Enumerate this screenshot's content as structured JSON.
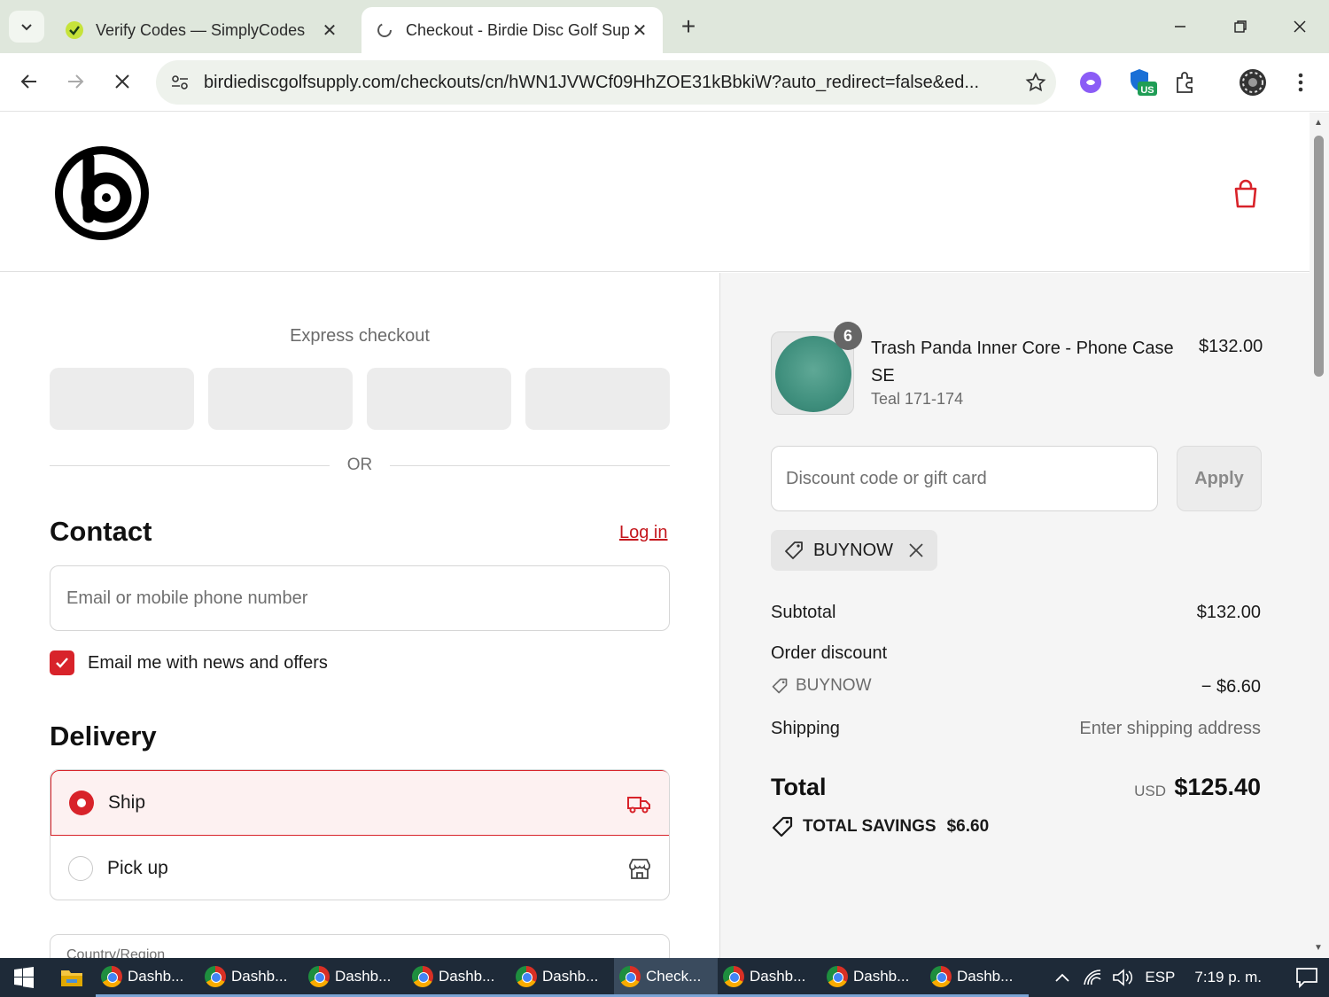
{
  "browser": {
    "tabs": [
      {
        "title": "Verify Codes — SimplyCodes",
        "active": false
      },
      {
        "title": "Checkout - Birdie Disc Golf Sup",
        "active": true
      }
    ],
    "url": "birdiediscgolfsupply.com/checkouts/cn/hWN1JVWCf09HhZOE31kBbkiW?auto_redirect=false&ed...",
    "ext_badge": "US"
  },
  "checkout": {
    "express_title": "Express checkout",
    "or_label": "OR",
    "contact": {
      "title": "Contact",
      "login_label": "Log in",
      "email_placeholder": "Email or mobile phone number",
      "newsletter_label": "Email me with news and offers",
      "newsletter_checked": true
    },
    "delivery": {
      "title": "Delivery",
      "options": [
        {
          "label": "Ship",
          "selected": true,
          "icon": "truck-icon"
        },
        {
          "label": "Pick up",
          "selected": false,
          "icon": "store-icon"
        }
      ],
      "country_label": "Country/Region"
    }
  },
  "summary": {
    "item": {
      "name": "Trash Panda Inner Core - Phone Case SE",
      "variant": "Teal 171-174",
      "price": "$132.00",
      "quantity": "6"
    },
    "discount_placeholder": "Discount code or gift card",
    "apply_label": "Apply",
    "applied_code": "BUYNOW",
    "subtotal_label": "Subtotal",
    "subtotal_value": "$132.00",
    "order_discount_label": "Order discount",
    "discount_code": "BUYNOW",
    "discount_value": "− $6.60",
    "shipping_label": "Shipping",
    "shipping_value": "Enter shipping address",
    "total_label": "Total",
    "total_currency": "USD",
    "total_value": "$125.40",
    "savings_label": "TOTAL SAVINGS",
    "savings_value": "$6.60"
  },
  "taskbar": {
    "apps": [
      {
        "label": "Dashb...",
        "active": false
      },
      {
        "label": "Dashb...",
        "active": false
      },
      {
        "label": "Dashb...",
        "active": false
      },
      {
        "label": "Dashb...",
        "active": false
      },
      {
        "label": "Dashb...",
        "active": false
      },
      {
        "label": "Check...",
        "active": true
      },
      {
        "label": "Dashb...",
        "active": false
      },
      {
        "label": "Dashb...",
        "active": false
      },
      {
        "label": "Dashb...",
        "active": false
      }
    ],
    "language": "ESP",
    "time": "7:19 p. m."
  },
  "colors": {
    "accent": "#d8232a",
    "summary_bg": "#f5f5f5",
    "tab_strip": "#dfe7dc"
  }
}
